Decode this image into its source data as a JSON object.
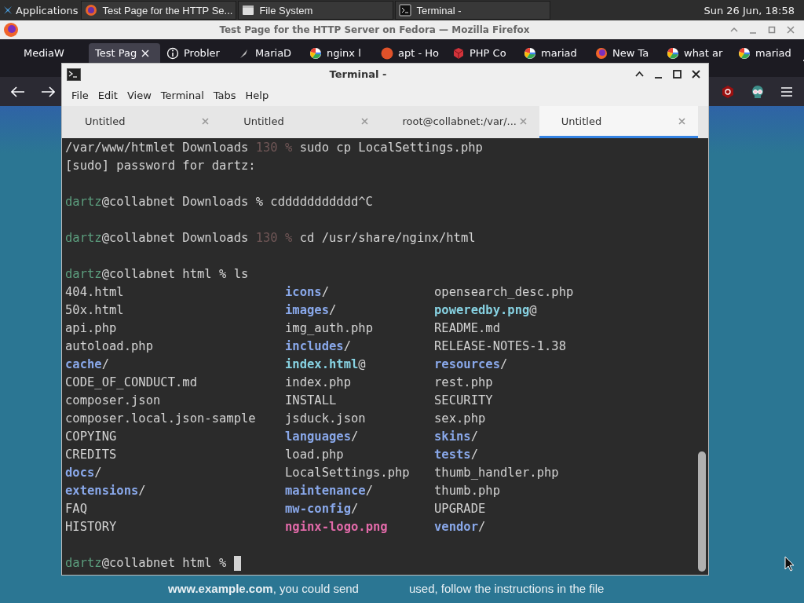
{
  "top_panel": {
    "applications": "Applications",
    "tasks": [
      {
        "label": "Test Page for the HTTP Se..."
      },
      {
        "label": "File System"
      },
      {
        "label": "Terminal -"
      }
    ],
    "clock": "Sun 26 Jun, 18:58"
  },
  "browser": {
    "title": "Test Page for the HTTP Server on Fedora — Mozilla Firefox",
    "tabs": [
      {
        "label": "MediaW",
        "selected": false
      },
      {
        "label": "Test Pag",
        "selected": true
      },
      {
        "label": "Probler",
        "selected": false
      },
      {
        "label": "MariaD",
        "selected": false
      },
      {
        "label": "nginx l",
        "selected": false
      },
      {
        "label": "apt - Ho",
        "selected": false
      },
      {
        "label": "PHP Co",
        "selected": false
      },
      {
        "label": "mariad",
        "selected": false
      },
      {
        "label": "New Ta",
        "selected": false
      },
      {
        "label": "what ar",
        "selected": false
      },
      {
        "label": "mariad",
        "selected": false
      }
    ],
    "page": {
      "columns": [
        {
          "text": "**www.example.com**, you could send"
        },
        {
          "text": "used, follow the instructions in the file"
        }
      ]
    }
  },
  "terminal": {
    "title": "Terminal -",
    "menu": [
      "File",
      "Edit",
      "View",
      "Terminal",
      "Tabs",
      "Help"
    ],
    "tabs": [
      {
        "label": "Untitled",
        "selected": false
      },
      {
        "label": "Untitled",
        "selected": false
      },
      {
        "label": "root@collabnet:/var/...",
        "selected": false
      },
      {
        "label": "Untitled",
        "selected": true
      }
    ],
    "lines": [
      {
        "kind": "text",
        "segments": [
          {
            "text": "/var/www/htmlet Downloads ",
            "kind": "normal"
          },
          {
            "text": "130 %",
            "kind": "dim"
          },
          {
            "text": " sudo cp LocalSettings.php",
            "kind": "normal"
          }
        ]
      },
      {
        "kind": "text",
        "segments": [
          {
            "text": "[sudo] password for dartz:",
            "kind": "normal"
          }
        ]
      },
      {
        "kind": "blank"
      },
      {
        "kind": "text",
        "segments": [
          {
            "text": "dartz",
            "kind": "user"
          },
          {
            "text": "@collabnet Downloads % cddddddddddd^C",
            "kind": "normal"
          }
        ]
      },
      {
        "kind": "blank"
      },
      {
        "kind": "text",
        "segments": [
          {
            "text": "dartz",
            "kind": "user"
          },
          {
            "text": "@collabnet Downloads ",
            "kind": "normal"
          },
          {
            "text": "130 %",
            "kind": "dim"
          },
          {
            "text": " cd /usr/share/nginx/html",
            "kind": "normal"
          }
        ]
      },
      {
        "kind": "blank"
      },
      {
        "kind": "text",
        "segments": [
          {
            "text": "dartz",
            "kind": "user"
          },
          {
            "text": "@collabnet html % ls",
            "kind": "normal"
          }
        ]
      },
      {
        "kind": "listing",
        "entries": [
          {
            "name": "404.html",
            "kind": "file"
          },
          {
            "name": "icons",
            "suffix": "/",
            "kind": "dir"
          },
          {
            "name": "opensearch_desc.php",
            "kind": "file"
          }
        ]
      },
      {
        "kind": "listing",
        "entries": [
          {
            "name": "50x.html",
            "kind": "file"
          },
          {
            "name": "images",
            "suffix": "/",
            "kind": "dir"
          },
          {
            "name": "poweredby.png",
            "suffix": "@",
            "kind": "link"
          }
        ]
      },
      {
        "kind": "listing",
        "entries": [
          {
            "name": "api.php",
            "kind": "file"
          },
          {
            "name": "img_auth.php",
            "kind": "file"
          },
          {
            "name": "README.md",
            "kind": "file"
          }
        ]
      },
      {
        "kind": "listing",
        "entries": [
          {
            "name": "autoload.php",
            "kind": "file"
          },
          {
            "name": "includes",
            "suffix": "/",
            "kind": "dir"
          },
          {
            "name": "RELEASE-NOTES-1.38",
            "kind": "file"
          }
        ]
      },
      {
        "kind": "listing",
        "entries": [
          {
            "name": "cache",
            "suffix": "/",
            "kind": "dir"
          },
          {
            "name": "index.html",
            "suffix": "@",
            "kind": "link"
          },
          {
            "name": "resources",
            "suffix": "/",
            "kind": "dir"
          }
        ]
      },
      {
        "kind": "listing",
        "entries": [
          {
            "name": "CODE_OF_CONDUCT.md",
            "kind": "file"
          },
          {
            "name": "index.php",
            "kind": "file"
          },
          {
            "name": "rest.php",
            "kind": "file"
          }
        ]
      },
      {
        "kind": "listing",
        "entries": [
          {
            "name": "composer.json",
            "kind": "file"
          },
          {
            "name": "INSTALL",
            "kind": "file"
          },
          {
            "name": "SECURITY",
            "kind": "file"
          }
        ]
      },
      {
        "kind": "listing",
        "entries": [
          {
            "name": "composer.local.json-sample",
            "kind": "file"
          },
          {
            "name": "jsduck.json",
            "kind": "file"
          },
          {
            "name": "sex.php",
            "kind": "file"
          }
        ]
      },
      {
        "kind": "listing",
        "entries": [
          {
            "name": "COPYING",
            "kind": "file"
          },
          {
            "name": "languages",
            "suffix": "/",
            "kind": "dir"
          },
          {
            "name": "skins",
            "suffix": "/",
            "kind": "dir"
          }
        ]
      },
      {
        "kind": "listing",
        "entries": [
          {
            "name": "CREDITS",
            "kind": "file"
          },
          {
            "name": "load.php",
            "kind": "file"
          },
          {
            "name": "tests",
            "suffix": "/",
            "kind": "dir"
          }
        ]
      },
      {
        "kind": "listing",
        "entries": [
          {
            "name": "docs",
            "suffix": "/",
            "kind": "dir"
          },
          {
            "name": "LocalSettings.php",
            "kind": "file"
          },
          {
            "name": "thumb_handler.php",
            "kind": "file"
          }
        ]
      },
      {
        "kind": "listing",
        "entries": [
          {
            "name": "extensions",
            "suffix": "/",
            "kind": "dir"
          },
          {
            "name": "maintenance",
            "suffix": "/",
            "kind": "dir"
          },
          {
            "name": "thumb.php",
            "kind": "file"
          }
        ]
      },
      {
        "kind": "listing",
        "entries": [
          {
            "name": "FAQ",
            "kind": "file"
          },
          {
            "name": "mw-config",
            "suffix": "/",
            "kind": "dir"
          },
          {
            "name": "UPGRADE",
            "kind": "file"
          }
        ]
      },
      {
        "kind": "listing",
        "entries": [
          {
            "name": "HISTORY",
            "kind": "file"
          },
          {
            "name": "nginx-logo.png",
            "kind": "image"
          },
          {
            "name": "vendor",
            "suffix": "/",
            "kind": "dir"
          }
        ]
      },
      {
        "kind": "blank"
      },
      {
        "kind": "text",
        "cursor": true,
        "segments": [
          {
            "text": "dartz",
            "kind": "user"
          },
          {
            "text": "@collabnet html % ",
            "kind": "normal"
          }
        ]
      }
    ]
  }
}
